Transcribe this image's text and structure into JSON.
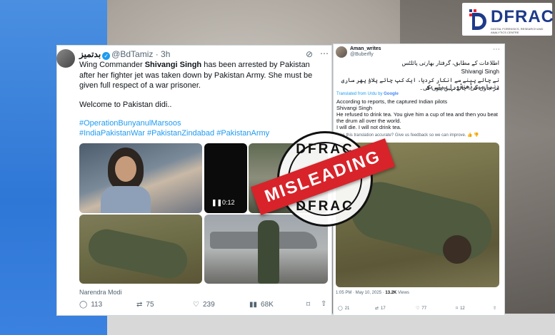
{
  "brand": {
    "name": "DFRAC",
    "tagline": "DIGITAL FORENSICS, RESEARCH AND ANALYTICS CENTRE"
  },
  "left_tweet": {
    "display_name": "بدتميز",
    "handle": "@BdTamiz",
    "age": "3h",
    "text_prefix": "Wing Commander ",
    "text_bold": "Shivangi Singh",
    "text_rest": " has been arrested by Pakistan after her fighter jet was taken down by Pakistan Army. She must be given full respect of a war prisoner.",
    "line2": "Welcome to Pakistan didi..",
    "hashtags_1": "#OperationBunyanulMarsoos",
    "hashtags_2": "#IndiaPakistanWar #PakistanZindabad #PakistanArmy",
    "video_time": "0:12",
    "media_caption": "Narendra Modi",
    "stats": {
      "replies": "113",
      "retweets": "75",
      "likes": "239",
      "views": "68K"
    }
  },
  "right_tweet": {
    "display_name": "Aman_writes",
    "handle": "@Buberfly",
    "urdu_1": "اطلاعات کے مطابق، گرفتار بھارتی پائلٹس",
    "urdu_2": "Shivangi Singh",
    "urdu_3": "نے چائے پینے سے انکار کردیا، ایک کپ چائے پلاؤ پھر ساری دنیا میں ڈھنڈورا پیٹے ہو",
    "urdu_4": "مر جاؤں گی، چائے نہیں پیوں گی۔",
    "translated_by": "Translated from Urdu by",
    "translator": "Google",
    "en_1": "According to reports, the captured Indian pilots",
    "en_2": "Shivangi Singh",
    "en_3": "He refused to drink tea. You give him a cup of tea and then you beat the drum all over the world.",
    "en_4": "I will die. I will not drink tea.",
    "feedback": "Was this translation accurate? Give us feedback so we can improve.",
    "timestamp": "1:05 PM · May 10, 2025 · ",
    "views": "13.2K",
    "views_label": " Views",
    "stats": {
      "replies": "21",
      "retweets": "17",
      "likes": "77",
      "bookmarks": "12"
    }
  },
  "stamp": {
    "top": "DFRAC",
    "bottom": "DFRAC",
    "label": "MISLEADING"
  },
  "colors": {
    "accent": "#1d9bf0",
    "stamp_red": "#d8232a",
    "brand_blue": "#1e3a8a"
  }
}
